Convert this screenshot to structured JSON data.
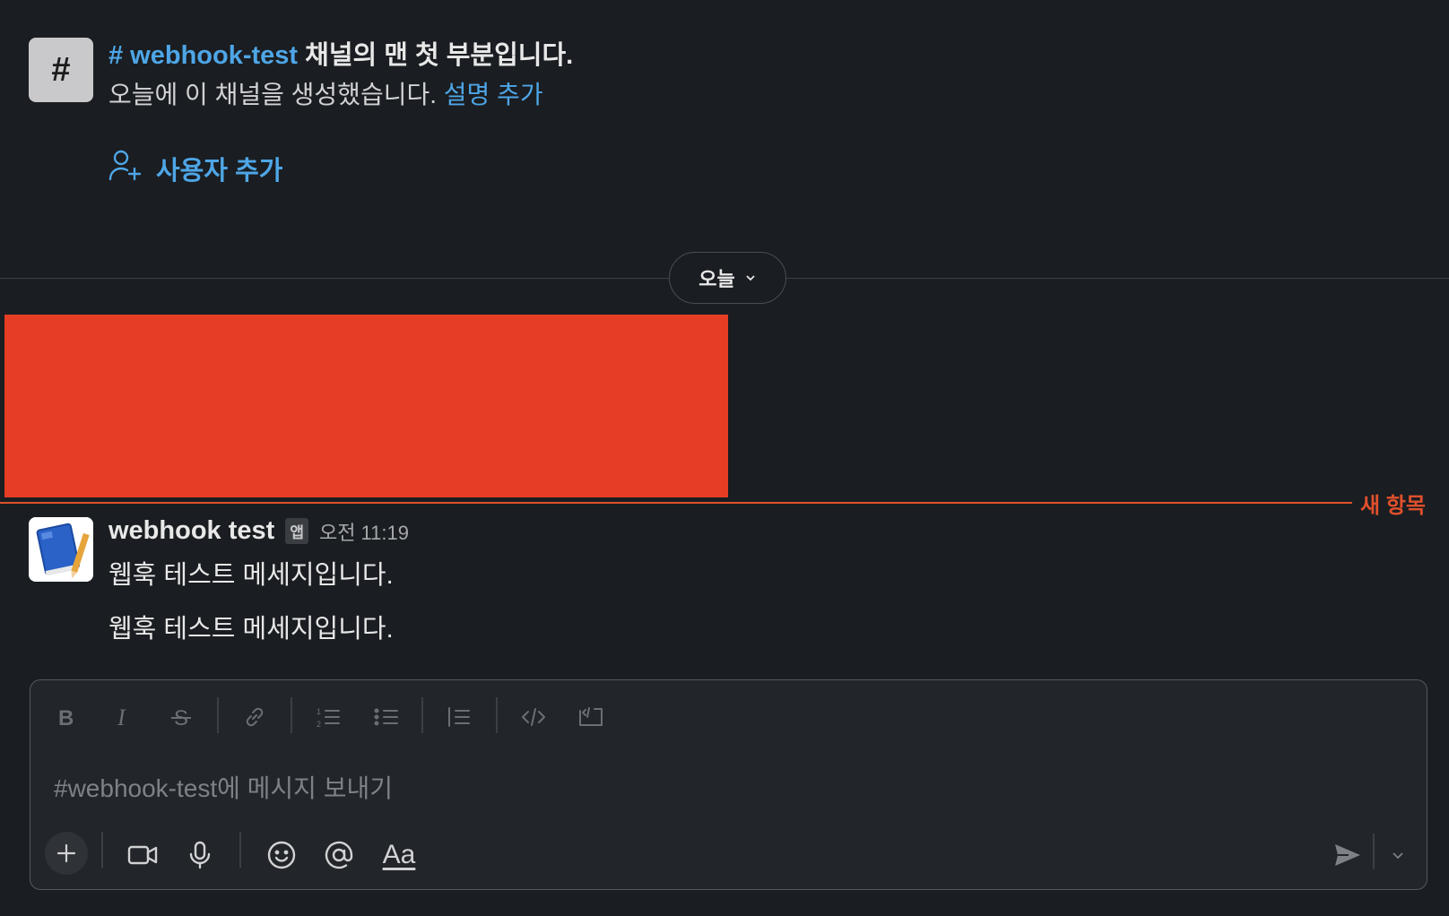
{
  "channel_intro": {
    "icon_glyph": "#",
    "channel_ref": "# webhook-test",
    "title_rest": " 채널의 맨 첫 부분입니다.",
    "created_text": "오늘에 이 채널을 생성했습니다. ",
    "add_description_link": "설명 추가",
    "add_user_label": "사용자 추가"
  },
  "date_divider": {
    "label": "오늘"
  },
  "new_items_divider": {
    "label": "새 항목",
    "color": "#e0502c"
  },
  "message": {
    "sender": "webhook test",
    "badge": "앱",
    "time": "오전 11:19",
    "lines": [
      "웹훅 테스트 메세지입니다.",
      "웹훅 테스트 메세지입니다."
    ]
  },
  "composer": {
    "placeholder": "#webhook-test에 메시지 보내기",
    "formatting_icons": [
      "bold-icon",
      "italic-icon",
      "strikethrough-icon",
      "link-icon",
      "ordered-list-icon",
      "bullet-list-icon",
      "blockquote-icon",
      "code-icon",
      "code-block-icon"
    ],
    "bottom_icons": [
      "plus-icon",
      "video-icon",
      "microphone-icon",
      "emoji-icon",
      "mention-icon",
      "text-format-icon",
      "send-icon",
      "chevron-down-icon"
    ],
    "format_label": "Aa"
  },
  "colors": {
    "link": "#4ea6e6",
    "redaction": "#e63e24",
    "background": "#1a1d21"
  }
}
